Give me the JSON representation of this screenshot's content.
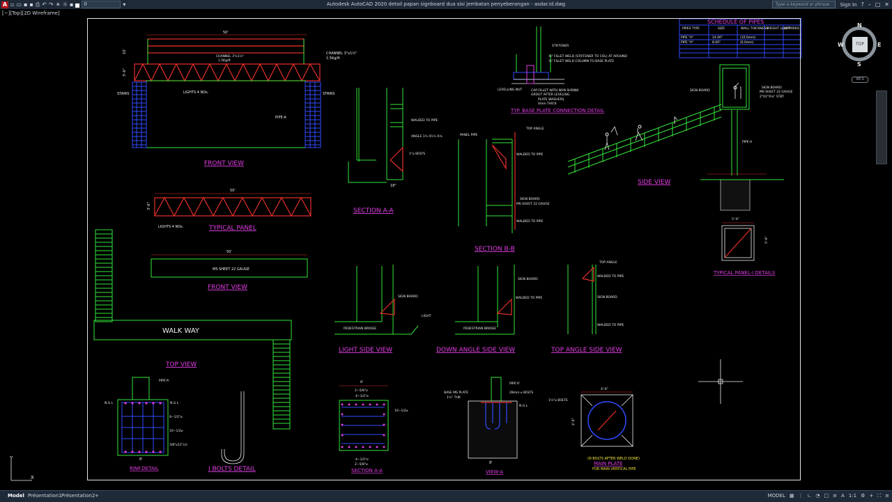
{
  "app": {
    "window_title": "Autodesk AutoCAD 2020   detail papan signboard dua sisi jembatan penyeberangan - asdar.id.dwg",
    "app_button": "A",
    "layer_name": "0",
    "search_placeholder": "Type a keyword or phrase",
    "sign_in": "Sign In",
    "viewport_label": "[−][Top][2D Wireframe]"
  },
  "viewcube": {
    "top": "TOP",
    "north": "N",
    "south": "S",
    "east": "E",
    "west": "W",
    "wcs": "WCS"
  },
  "status": {
    "tabs": [
      "Model",
      "Présentation1",
      "Présentation2",
      "+"
    ],
    "model_label": "MODEL",
    "scale": "1:1"
  },
  "drawing": {
    "front_view_title": "FRONT VIEW",
    "dim_50": "50'",
    "dim_10": "10'",
    "dim_3_6": "3'-6\"",
    "channel": "CHANNEL 3\"x1½\"",
    "channel2": "1.5Kg/ft",
    "channel_mid": "CHANNEL 3\"x1½\"",
    "channel_mid2": "1.5Kg/ft",
    "stairs": "STAIRS",
    "lights": "LIGHTS 4 NOs.",
    "pipe_a": "PIPE-A",
    "typical_panel": "TYPICAL PANEL",
    "lights4": "LIGHTS 4 NOs.",
    "front_view2": "FRONT VIEW",
    "ms_sheet": "MS SHEET 22 GAUGE",
    "walkway": "WALK WAY",
    "top_view": "TOP VIEW",
    "section_aa": "SECTION A-A",
    "walded_pipe": "WALDED TO PIPE",
    "angle": "ANGLE 1½ X1½ X⅛",
    "bolts": "1\"⌀ BOLTS",
    "dim_18": "18\"",
    "panel_pipe": "PANEL PIPE",
    "top_angle": "TOP ANGLE",
    "sign_board_ms": "SIGN BOARD",
    "ms_sheet_22": "MS SHEET 22 GAUGE",
    "section_bb": "SECTION B-B",
    "stiffener": "STIFFENER",
    "fillet1": "⅜\" FILLET WELD (STIFFENER TO COL) AT AROUND",
    "fillet2": "⅜\" FILLET WELD COLUMN TO BASE PLATE",
    "leveling": "LEVELLING NUT",
    "cap_fillet": "CAP FILLET WITH NON SHRINK",
    "grout": "GROUT AFTER LEVELING",
    "plate_washers": "PLATE WASHERS",
    "thick": "4mm THICK",
    "base_plate_title": "TYP. BASE PLATE CONNECTION DETAIL",
    "schedule_title": "SCHEDULE OF PIPES",
    "sched_headers": [
      "PIPES TYPE",
      "SIZE",
      "WALL THICKNESS",
      "WEIGHT Lbs/FT",
      "REMARKS"
    ],
    "sched_rows": [
      [
        "PIPE \"A\"",
        "14.00\"",
        "(10.0mm)"
      ],
      [
        "PIPE \"A\"",
        "8.00\"",
        "(6.0mm)"
      ]
    ],
    "sign_board": "SIGN BOARD",
    "sign_board2": "SIGN BOARD",
    "ms22": "MS SHEET 22 GAUGE",
    "angle2": "2\"X2\"X⅛\" STKT",
    "side_view": "SIDE VIEW",
    "dim_5_0": "5'-0\"",
    "dim_5_6": "5'-6\"",
    "typ_panel_details": "TYPICAL PANEL-I DETAILS",
    "sign_board_l": "SIGN BOARD",
    "pedestrian": "PEDESTRIAN BRIDGE",
    "light": "LIGHT",
    "light_side": "LIGHT SIDE VIEW",
    "down_angle": "DOWN ANGLE SIDE VIEW",
    "top_angle_side": "TOP ANGLE SIDE VIEW",
    "pipe_a2": "PIPE'A'",
    "ngl": "N.G.L",
    "rinf_detail": "RINF.DETAIL",
    "j_bolts": "J BOLTS DETAIL",
    "section_aa2": "SECTION A-A",
    "view_a": "VIEW-A",
    "base_ms": "BASE MS PLATE",
    "thk": "1½\" THK",
    "bolts28": "28mm ⌀ BOLTS",
    "bolts_note": "1½\"⌀ BOLTS",
    "main_plate": "MAIN PLATE",
    "main_plate_note": "(N BOLTS AFTER WELD DONE)",
    "main_plate_note2": "FOR MAIN VERTICAL PIPE",
    "dim_8": "8'",
    "dim_4_6": "4'-6\"",
    "dim_2_5_8": "2−5/8\"⌀",
    "dim_4_1_2": "4−1/2\"⌀",
    "dim_10_1_2": "10−1/2⌀",
    "dim_8_1_2": "8−1/2\"⌀",
    "dim_3_8": "3/8\"⌀12\"c/c"
  },
  "colors": {
    "red": "#e8312b",
    "green": "#35e83a",
    "magenta": "#e23ee6",
    "blue": "#2f4bff",
    "white": "#f2f2f2",
    "yellow": "#f5e83a",
    "cyan": "#3ad7e8"
  }
}
